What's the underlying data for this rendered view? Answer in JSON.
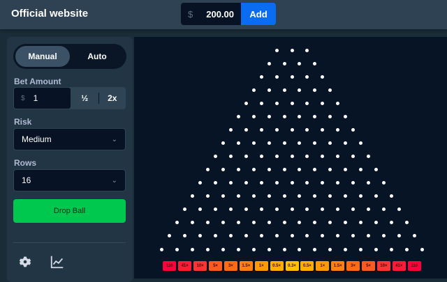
{
  "header": {
    "title": "Official website",
    "currency": "$",
    "balance": "200.00",
    "add_label": "Add"
  },
  "panel": {
    "modes": [
      "Manual",
      "Auto"
    ],
    "active_mode": "Manual",
    "bet_label": "Bet Amount",
    "bet_currency": "$",
    "bet_value": "1",
    "half_label": "½",
    "double_label": "2x",
    "risk_label": "Risk",
    "risk_value": "Medium",
    "rows_label": "Rows",
    "rows_value": "16",
    "drop_label": "Drop Ball"
  },
  "board": {
    "rows": 16,
    "multipliers": [
      "110",
      "41×",
      "10×",
      "5×",
      "3×",
      "1.5×",
      "1×",
      "0.5×",
      "0.3×",
      "0.5×",
      "1×",
      "1.5×",
      "3×",
      "5×",
      "10×",
      "41×",
      "110"
    ],
    "colors": [
      "#ff003f",
      "#ff1a3a",
      "#ff3535",
      "#ff5a20",
      "#ff6a14",
      "#ff8010",
      "#ff9a05",
      "#ffae00",
      "#ffc000",
      "#ffae00",
      "#ff9a05",
      "#ff8010",
      "#ff6a14",
      "#ff5a20",
      "#ff3535",
      "#ff1a3a",
      "#ff003f"
    ]
  }
}
